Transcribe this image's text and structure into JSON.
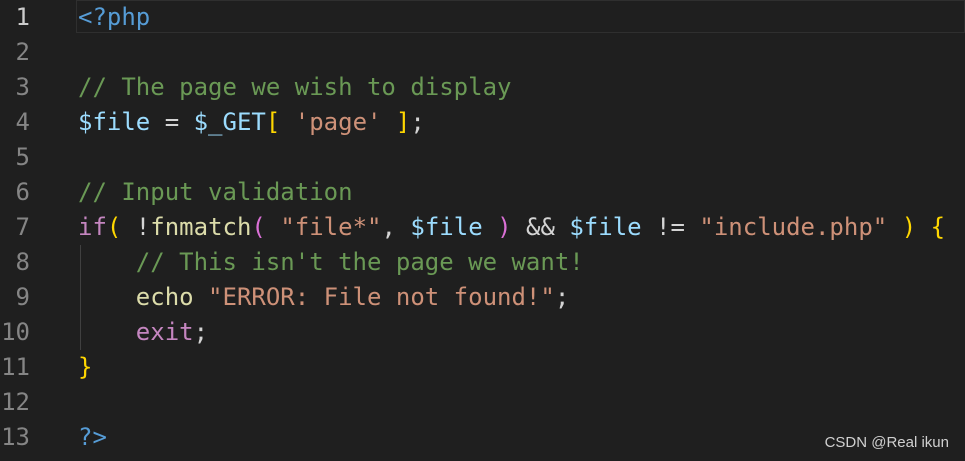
{
  "editor": {
    "lines": [
      {
        "number": "1",
        "tokens": [
          {
            "text": "<?php",
            "kind": "tag"
          }
        ]
      },
      {
        "number": "2",
        "tokens": []
      },
      {
        "number": "3",
        "tokens": [
          {
            "text": "// The page we wish to display",
            "kind": "com"
          }
        ]
      },
      {
        "number": "4",
        "tokens": [
          {
            "text": "$file",
            "kind": "var"
          },
          {
            "text": " = ",
            "kind": "plain"
          },
          {
            "text": "$_GET",
            "kind": "var"
          },
          {
            "text": "[",
            "kind": "br1"
          },
          {
            "text": " ",
            "kind": "plain"
          },
          {
            "text": "'page'",
            "kind": "str"
          },
          {
            "text": " ",
            "kind": "plain"
          },
          {
            "text": "]",
            "kind": "br1"
          },
          {
            "text": ";",
            "kind": "plain"
          }
        ]
      },
      {
        "number": "5",
        "tokens": []
      },
      {
        "number": "6",
        "tokens": [
          {
            "text": "// Input validation",
            "kind": "com"
          }
        ]
      },
      {
        "number": "7",
        "tokens": [
          {
            "text": "if",
            "kind": "kw"
          },
          {
            "text": "(",
            "kind": "br1"
          },
          {
            "text": " !",
            "kind": "plain"
          },
          {
            "text": "fnmatch",
            "kind": "fn"
          },
          {
            "text": "(",
            "kind": "br2"
          },
          {
            "text": " ",
            "kind": "plain"
          },
          {
            "text": "\"file*\"",
            "kind": "str"
          },
          {
            "text": ", ",
            "kind": "plain"
          },
          {
            "text": "$file",
            "kind": "var"
          },
          {
            "text": " ",
            "kind": "plain"
          },
          {
            "text": ")",
            "kind": "br2"
          },
          {
            "text": " && ",
            "kind": "plain"
          },
          {
            "text": "$file",
            "kind": "var"
          },
          {
            "text": " != ",
            "kind": "plain"
          },
          {
            "text": "\"include.php\"",
            "kind": "str"
          },
          {
            "text": " ",
            "kind": "plain"
          },
          {
            "text": ")",
            "kind": "br1"
          },
          {
            "text": " ",
            "kind": "plain"
          },
          {
            "text": "{",
            "kind": "br1"
          }
        ]
      },
      {
        "number": "8",
        "tokens": [
          {
            "text": "    ",
            "kind": "plain"
          },
          {
            "text": "// This isn't the page we want!",
            "kind": "com"
          }
        ]
      },
      {
        "number": "9",
        "tokens": [
          {
            "text": "    ",
            "kind": "plain"
          },
          {
            "text": "echo",
            "kind": "fn"
          },
          {
            "text": " ",
            "kind": "plain"
          },
          {
            "text": "\"ERROR: File not found!\"",
            "kind": "str"
          },
          {
            "text": ";",
            "kind": "plain"
          }
        ]
      },
      {
        "number": "10",
        "tokens": [
          {
            "text": "    ",
            "kind": "plain"
          },
          {
            "text": "exit",
            "kind": "kw"
          },
          {
            "text": ";",
            "kind": "plain"
          }
        ]
      },
      {
        "number": "11",
        "tokens": [
          {
            "text": "}",
            "kind": "br1"
          }
        ]
      },
      {
        "number": "12",
        "tokens": []
      },
      {
        "number": "13",
        "tokens": [
          {
            "text": "?>",
            "kind": "tag"
          }
        ]
      }
    ]
  },
  "watermark": "CSDN @Real  ikun",
  "colors": {
    "background": "#1f1f1f",
    "comment": "#6a9955",
    "variable": "#9cdcfe",
    "string": "#ce9178",
    "keyword": "#c586c0",
    "php_tag": "#569cd6",
    "bracket_gold": "#ffd700",
    "bracket_violet": "#da70d6"
  }
}
